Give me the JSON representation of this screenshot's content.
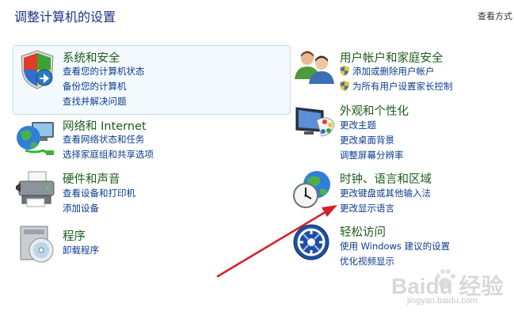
{
  "header": {
    "title": "调整计算机的设置",
    "view_by": "查看方式"
  },
  "categories": {
    "system": {
      "title": "系统和安全",
      "icon": "shield-icon",
      "links": [
        "查看您的计算机状态",
        "备份您的计算机",
        "查找并解决问题"
      ]
    },
    "network": {
      "title": "网络和 Internet",
      "icon": "network-globe-icon",
      "links": [
        "查看网络状态和任务",
        "选择家庭组和共享选项"
      ]
    },
    "hardware": {
      "title": "硬件和声音",
      "icon": "printer-icon",
      "links": [
        "查看设备和打印机",
        "添加设备"
      ]
    },
    "programs": {
      "title": "程序",
      "icon": "programs-disc-icon",
      "links": [
        "卸载程序"
      ]
    },
    "users": {
      "title": "用户帐户和家庭安全",
      "icon": "users-icon",
      "links": [
        "添加或删除用户帐户",
        "为所有用户设置家长控制"
      ]
    },
    "appearance": {
      "title": "外观和个性化",
      "icon": "monitor-palette-icon",
      "links": [
        "更改主题",
        "更改桌面背景",
        "调整屏幕分辨率"
      ]
    },
    "clock": {
      "title": "时钟、语言和区域",
      "icon": "clock-globe-icon",
      "links": [
        "更改键盘或其他输入法",
        "更改显示语言"
      ]
    },
    "ease": {
      "title": "轻松访问",
      "icon": "ease-of-access-icon",
      "links": [
        "使用 Windows 建议的设置",
        "优化视频显示"
      ]
    }
  },
  "annotation": {
    "arrow_color": "#d4202a"
  },
  "watermark": {
    "brand": "Baidu 经验",
    "url": "jingyan.baidu.com"
  }
}
